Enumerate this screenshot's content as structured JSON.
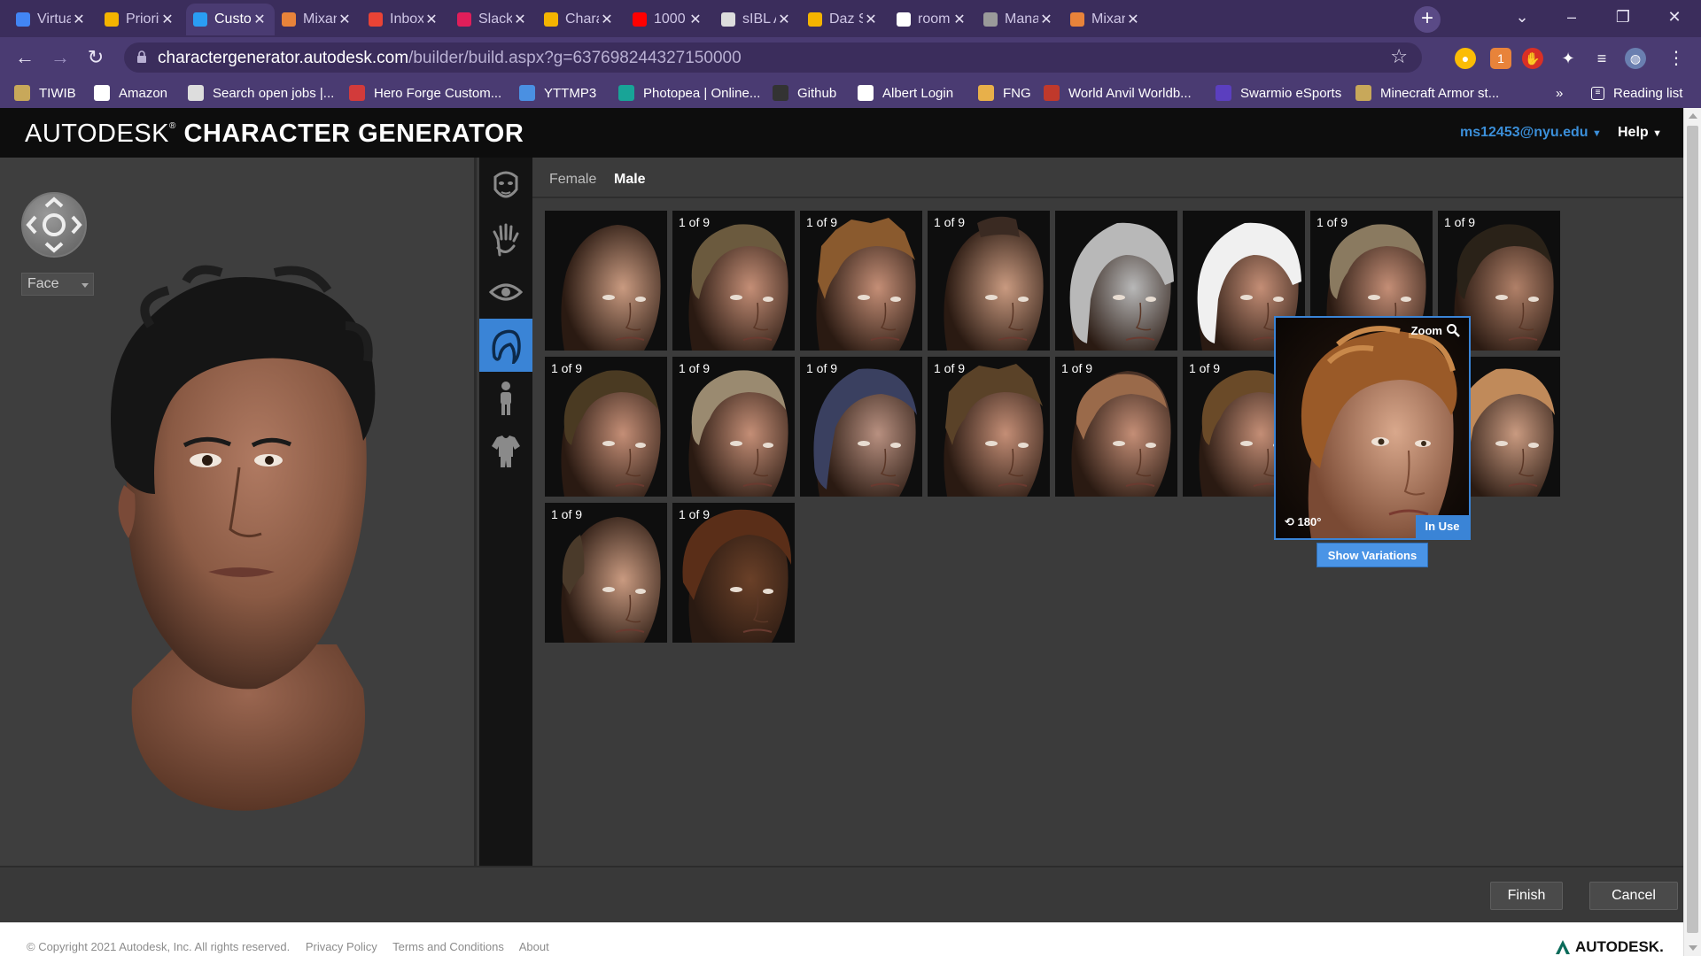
{
  "browser": {
    "tabs": [
      {
        "title": "Virtua",
        "icon": "docs-icon",
        "color": "#4285f4",
        "active": false
      },
      {
        "title": "Priorit",
        "icon": "drive-icon",
        "color": "#f4b400",
        "active": false
      },
      {
        "title": "Custo",
        "icon": "autodesk-icon",
        "color": "#2a9df4",
        "active": true
      },
      {
        "title": "Mixan",
        "icon": "mixamo-icon",
        "color": "#e8833a",
        "active": false
      },
      {
        "title": "Inbox",
        "icon": "gmail-icon",
        "color": "#ea4335",
        "active": false
      },
      {
        "title": "Slack",
        "icon": "slack-icon",
        "color": "#e01e5a",
        "active": false
      },
      {
        "title": "Chara",
        "icon": "slides-icon",
        "color": "#f4b400",
        "active": false
      },
      {
        "title": "1000",
        "icon": "youtube-icon",
        "color": "#ff0000",
        "active": false
      },
      {
        "title": "sIBL A",
        "icon": "search-icon",
        "color": "#dddddd",
        "active": false
      },
      {
        "title": "Daz St",
        "icon": "slides-icon",
        "color": "#f4b400",
        "active": false
      },
      {
        "title": "room",
        "icon": "google-icon",
        "color": "#ffffff",
        "active": false
      },
      {
        "title": "Mana",
        "icon": "globe-icon",
        "color": "#9a9a9a",
        "active": false
      },
      {
        "title": "Mixan",
        "icon": "mixamo-icon",
        "color": "#e8833a",
        "active": false
      }
    ],
    "url_host": "charactergenerator.autodesk.com",
    "url_path": "/builder/build.aspx?g=637698244327150000",
    "bookmarks": [
      {
        "label": "TIWIB",
        "icon": "tiwib-icon",
        "color": "#c8a85a"
      },
      {
        "label": "Amazon",
        "icon": "amazon-icon",
        "color": "#ffffff"
      },
      {
        "label": "Search open jobs |...",
        "icon": "megaphone-icon",
        "color": "#dddddd"
      },
      {
        "label": "Hero Forge Custom...",
        "icon": "heroforge-icon",
        "color": "#d23b3b"
      },
      {
        "label": "YTTMP3",
        "icon": "yttmp3-icon",
        "color": "#4a90e2"
      },
      {
        "label": "Photopea | Online...",
        "icon": "photopea-icon",
        "color": "#18a497"
      },
      {
        "label": "Github",
        "icon": "github-icon",
        "color": "#333333"
      },
      {
        "label": "Albert Login",
        "icon": "globe-icon",
        "color": "#ffffff"
      },
      {
        "label": "FNG",
        "icon": "fng-icon",
        "color": "#e8b04a"
      },
      {
        "label": "World Anvil Worldb...",
        "icon": "worldanvil-icon",
        "color": "#c0392b"
      },
      {
        "label": "Swarmio eSports",
        "icon": "swarmio-icon",
        "color": "#5b3fbf"
      },
      {
        "label": "Minecraft Armor st...",
        "icon": "minecraft-icon",
        "color": "#c8a85a"
      }
    ],
    "overflow_label": "»",
    "reading_list": "Reading list"
  },
  "app": {
    "brand_light": "AUTODESK",
    "brand_reg": "®",
    "brand_bold": "CHARACTER GENERATOR",
    "user": "ms12453@nyu.edu",
    "help": "Help",
    "viewport": {
      "view_select": "Face"
    },
    "tools": [
      {
        "name": "face-tool",
        "active": false
      },
      {
        "name": "hand-tool",
        "active": false
      },
      {
        "name": "eye-tool",
        "active": false
      },
      {
        "name": "hair-tool",
        "active": true
      },
      {
        "name": "body-tool",
        "active": false
      },
      {
        "name": "clothing-tool",
        "active": false
      }
    ],
    "gender_tabs": {
      "female": "Female",
      "male": "Male",
      "active": "Male"
    },
    "tiles": [
      {
        "count": "",
        "hair": "#c99a80",
        "skin": "#c99a80",
        "style": "bald"
      },
      {
        "count": "1 of 9",
        "hair": "#6b5a3e",
        "skin": "#c48e76",
        "style": "short"
      },
      {
        "count": "1 of 9",
        "hair": "#8a5a2e",
        "skin": "#c48e76",
        "style": "spiky"
      },
      {
        "count": "1 of 9",
        "hair": "#3a2a22",
        "skin": "#c99a80",
        "style": "mohawk"
      },
      {
        "count": "",
        "hair": "#b8b8b8",
        "skin": "#b8b8b8",
        "style": "cap-silver"
      },
      {
        "count": "",
        "hair": "#f0f0f0",
        "skin": "#c48e76",
        "style": "cap-white"
      },
      {
        "count": "1 of 9",
        "hair": "#8a7a60",
        "skin": "#c48e76",
        "style": "fringe"
      },
      {
        "count": "1 of 9",
        "hair": "#2a2218",
        "skin": "#b08068",
        "style": "braids"
      },
      {
        "count": "1 of 9",
        "hair": "#4a3a22",
        "skin": "#c48e76",
        "style": "side"
      },
      {
        "count": "1 of 9",
        "hair": "#9a8a70",
        "skin": "#c48e76",
        "style": "short"
      },
      {
        "count": "1 of 9",
        "hair": "#3a4060",
        "skin": "#b89080",
        "style": "swept"
      },
      {
        "count": "1 of 9",
        "hair": "#5a4228",
        "skin": "#c48e76",
        "style": "curly"
      },
      {
        "count": "1 of 9",
        "hair": "#9a6a4a",
        "skin": "#c48e76",
        "style": "buzz"
      },
      {
        "count": "1 of 9",
        "hair": "#6a4a28",
        "skin": "#c48e76",
        "style": "short"
      },
      {
        "count": "",
        "hair": "#8a6a40",
        "skin": "#c48e76",
        "style": "short"
      },
      {
        "count": "",
        "hair": "#c08a5a",
        "skin": "#c99a80",
        "style": "long"
      },
      {
        "count": "1 of 9",
        "hair": "#4a3a2a",
        "skin": "#c99a80",
        "style": "receding"
      },
      {
        "count": "1 of 9",
        "hair": "#5a2e18",
        "skin": "#6a4028",
        "style": "afro"
      }
    ],
    "popup": {
      "zoom": "Zoom",
      "rotate": "180°",
      "in_use": "In Use",
      "show_variations": "Show Variations"
    },
    "buttons": {
      "finish": "Finish",
      "cancel": "Cancel"
    },
    "footer": {
      "copyright": "© Copyright 2021 Autodesk, Inc. All rights reserved.",
      "privacy": "Privacy Policy",
      "terms": "Terms and Conditions",
      "about": "About",
      "logo": "AUTODESK."
    }
  }
}
